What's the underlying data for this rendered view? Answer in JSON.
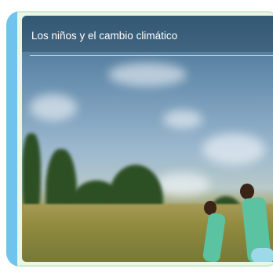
{
  "card": {
    "title": "Los niños y el cambio climático"
  },
  "colors": {
    "frame_background": "#eaf6e6",
    "accent": "#6fc3ec",
    "title_text": "#ffffff"
  }
}
